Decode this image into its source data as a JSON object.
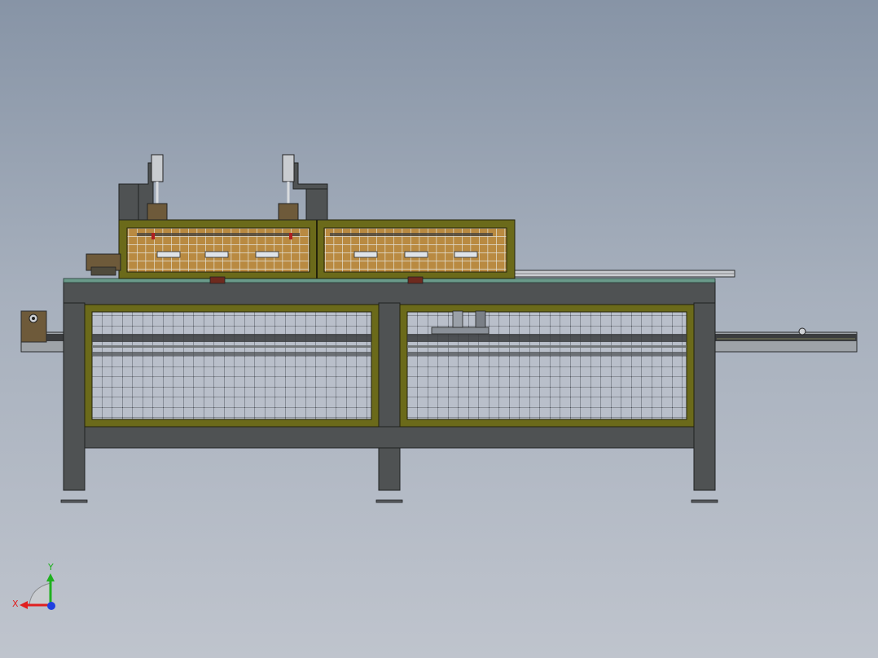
{
  "viewport": {
    "background_top": "#8794a6",
    "background_bottom": "#bfc4cd"
  },
  "model": {
    "frame_color": "#4f5253",
    "guard_frame_color": "#6b6a1a",
    "panel_wood_color": "#b5843c",
    "mesh_color": "#2a2e33",
    "plate_color": "#5a7a6a"
  },
  "triad": {
    "x_label": "X",
    "y_label": "Y",
    "x_color": "#e02020",
    "y_color": "#1fb01f",
    "z_color": "#2040e0"
  }
}
